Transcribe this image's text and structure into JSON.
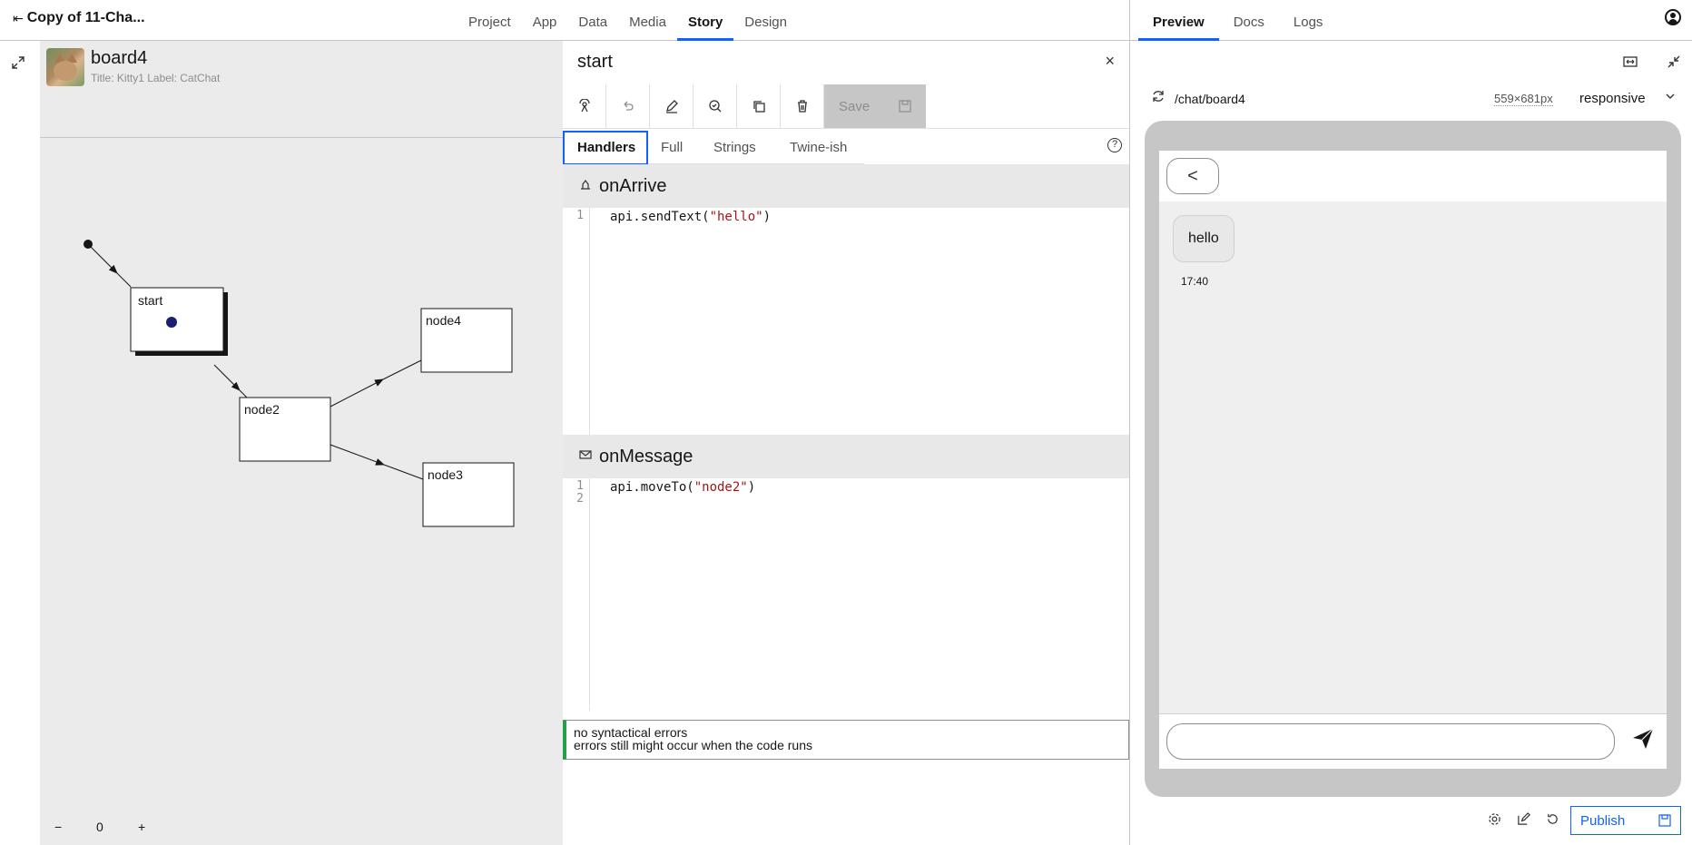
{
  "app": {
    "back_label": "Copy of 11-Cha...",
    "back_arrow": "⇤"
  },
  "nav": [
    {
      "label": "Project"
    },
    {
      "label": "App"
    },
    {
      "label": "Data"
    },
    {
      "label": "Media"
    },
    {
      "label": "Story"
    },
    {
      "label": "Design"
    }
  ],
  "preview_tabs": [
    {
      "label": "Preview"
    },
    {
      "label": "Docs"
    },
    {
      "label": "Logs"
    }
  ],
  "board": {
    "name": "board4",
    "subtitle": "Title: Kitty1 Label: CatChat",
    "zoom_minus": "−",
    "zoom_value": "0",
    "zoom_plus": "+",
    "nodes": [
      {
        "label": "start"
      },
      {
        "label": "node4"
      },
      {
        "label": "node2"
      },
      {
        "label": "node3"
      }
    ]
  },
  "editor": {
    "node_name": "start",
    "close": "×",
    "save_label": "Save",
    "tabs": [
      {
        "label": "Handlers"
      },
      {
        "label": "Full"
      },
      {
        "label": "Strings"
      },
      {
        "label": "Twine-ish"
      }
    ],
    "help": "?",
    "on_arrive": {
      "title": "onArrive",
      "line_numbers": "1",
      "code_prefix": "api.sendText(",
      "code_string": "\"hello\"",
      "code_suffix": ")"
    },
    "on_message": {
      "title": "onMessage",
      "line_numbers_1": "1",
      "line_numbers_2": "2",
      "code_prefix": "api.moveTo(",
      "code_string": "\"node2\"",
      "code_suffix": ")"
    },
    "lint_line1": "no syntactical errors",
    "lint_line2": "errors still might occur when the code runs"
  },
  "preview": {
    "path": "/chat/board4",
    "size": "559×681px",
    "mode": "responsive",
    "back_glyph": "<",
    "message": "hello",
    "time": "17:40",
    "publish_label": "Publish"
  },
  "colors": {
    "accent": "#0f62fe",
    "success": "#24a148",
    "string": "#a31515"
  }
}
